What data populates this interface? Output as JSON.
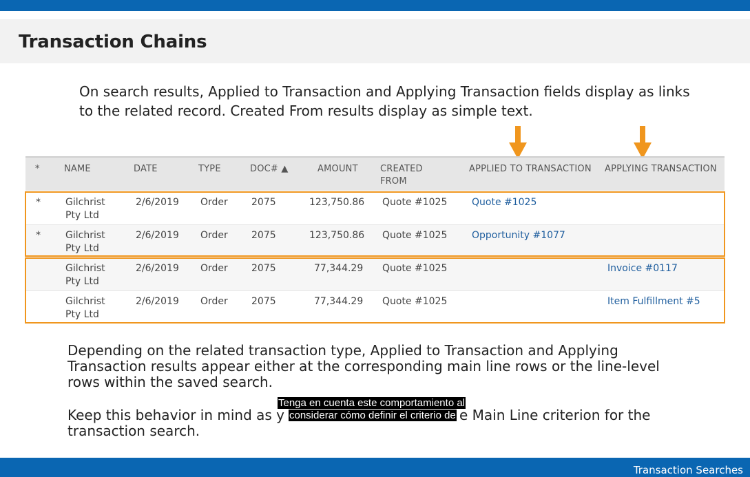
{
  "header": {
    "title": "Transaction Chains"
  },
  "intro": {
    "line1": "On search results, Applied to Transaction and Applying Transaction fields display as links",
    "line2": "to the related record. Created From results display as simple text."
  },
  "colors": {
    "brand_blue": "#0a66b2",
    "highlight_orange": "#f0961e",
    "link_blue": "#1f5e9e"
  },
  "table": {
    "columns": {
      "star": "*",
      "name": "NAME",
      "date": "DATE",
      "type": "TYPE",
      "doc": "DOC# ▲",
      "amount": "AMOUNT",
      "created_line1": "CREATED",
      "created_line2": "FROM",
      "applied_to": "APPLIED TO TRANSACTION",
      "applying": "APPLYING TRANSACTION"
    },
    "rows": [
      {
        "star": "*",
        "name1": "Gilchrist",
        "name2": "Pty Ltd",
        "date": "2/6/2019",
        "type": "Order",
        "doc": "2075",
        "amount": "123,750.86",
        "created_from": "Quote #1025",
        "applied_to": "Quote #1025",
        "applying": ""
      },
      {
        "star": "*",
        "name1": "Gilchrist",
        "name2": "Pty Ltd",
        "date": "2/6/2019",
        "type": "Order",
        "doc": "2075",
        "amount": "123,750.86",
        "created_from": "Quote #1025",
        "applied_to": "Opportunity #1077",
        "applying": ""
      },
      {
        "star": "",
        "name1": "Gilchrist",
        "name2": "Pty Ltd",
        "date": "2/6/2019",
        "type": "Order",
        "doc": "2075",
        "amount": "77,344.29",
        "created_from": "Quote #1025",
        "applied_to": "",
        "applying": "Invoice #0117"
      },
      {
        "star": "",
        "name1": "Gilchrist",
        "name2": "Pty Ltd",
        "date": "2/6/2019",
        "type": "Order",
        "doc": "2075",
        "amount": "77,344.29",
        "created_from": "Quote #1025",
        "applied_to": "",
        "applying": "Item Fulfillment #5"
      }
    ]
  },
  "body": {
    "p1_line1": "Depending on the related transaction type, Applied to Transaction and Applying",
    "p1_line2": "Transaction results appear either at the corresponding main line rows or the line-level",
    "p1_line3": "rows within the saved search.",
    "p2_line1_start": "Keep this behavior in mind as y",
    "p2_line1_end": "e Main Line criterion for the",
    "p2_line2": "transaction search."
  },
  "captions": {
    "line1": "Tenga en cuenta este comportamiento al",
    "line2": "considerar cómo definir el criterio de"
  },
  "footer": {
    "label": "Transaction Searches"
  }
}
